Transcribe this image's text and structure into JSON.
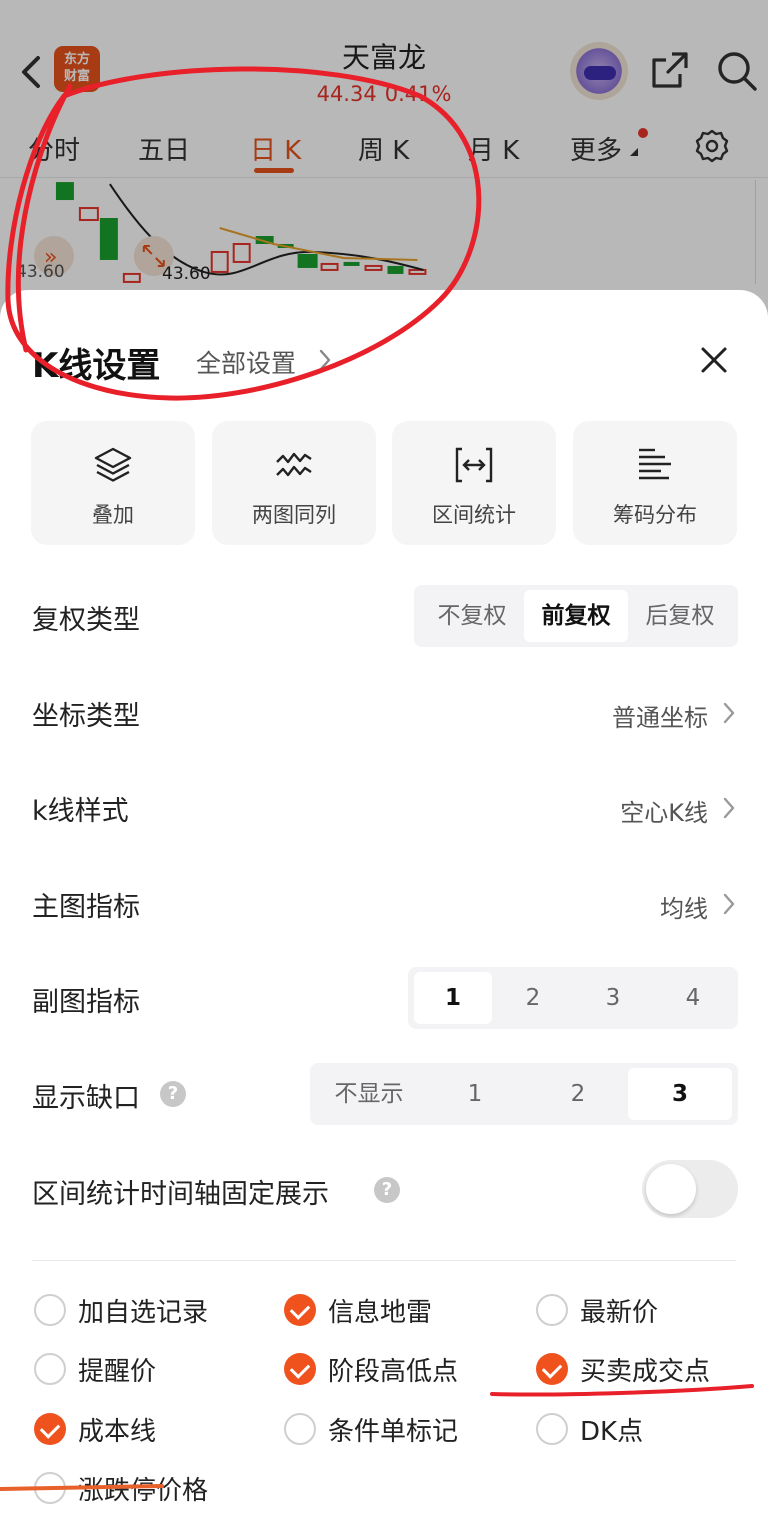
{
  "header": {
    "stock_name": "天富龙",
    "price": "44.34",
    "change_pct": "0.41%",
    "logo_text": "东方财富"
  },
  "tabs": [
    {
      "label": "分时",
      "active": false
    },
    {
      "label": "五日",
      "active": false
    },
    {
      "label": "日 K",
      "active": true
    },
    {
      "label": "周 K",
      "active": false
    },
    {
      "label": "月 K",
      "active": false
    },
    {
      "label": "更多",
      "active": false
    }
  ],
  "chart": {
    "low_label_left": "43.60",
    "low_label_mid": "43.60"
  },
  "sheet": {
    "title": "K线设置",
    "all_settings": "全部设置",
    "tools": [
      {
        "label": "叠加",
        "icon": "layers-icon"
      },
      {
        "label": "两图同列",
        "icon": "dual-chart-icon"
      },
      {
        "label": "区间统计",
        "icon": "range-stat-icon"
      },
      {
        "label": "筹码分布",
        "icon": "chip-distribution-icon"
      }
    ],
    "fuquan": {
      "label": "复权类型",
      "options": [
        "不复权",
        "前复权",
        "后复权"
      ],
      "selected": "前复权"
    },
    "coord": {
      "label": "坐标类型",
      "value": "普通坐标"
    },
    "kline_style": {
      "label": "k线样式",
      "value": "空心K线"
    },
    "main_indicator": {
      "label": "主图指标",
      "value": "均线"
    },
    "sub_indicator": {
      "label": "副图指标",
      "options": [
        "1",
        "2",
        "3",
        "4"
      ],
      "selected": "1"
    },
    "gap": {
      "label": "显示缺口",
      "options": [
        "不显示",
        "1",
        "2",
        "3"
      ],
      "selected": "3"
    },
    "range_axis": {
      "label": "区间统计时间轴固定展示",
      "enabled": false
    },
    "checkboxes": [
      {
        "label": "加自选记录",
        "checked": false
      },
      {
        "label": "信息地雷",
        "checked": true
      },
      {
        "label": "最新价",
        "checked": false
      },
      {
        "label": "提醒价",
        "checked": false
      },
      {
        "label": "阶段高低点",
        "checked": true
      },
      {
        "label": "买卖成交点",
        "checked": true
      },
      {
        "label": "成本线",
        "checked": true
      },
      {
        "label": "条件单标记",
        "checked": false
      },
      {
        "label": "DK点",
        "checked": false
      },
      {
        "label": "涨跌停价格",
        "checked": false
      }
    ]
  },
  "colors": {
    "accent": "#f0521e",
    "price_red": "#e8342a",
    "annotation_red": "#e8202a",
    "annotation_orange": "#e8602a"
  }
}
